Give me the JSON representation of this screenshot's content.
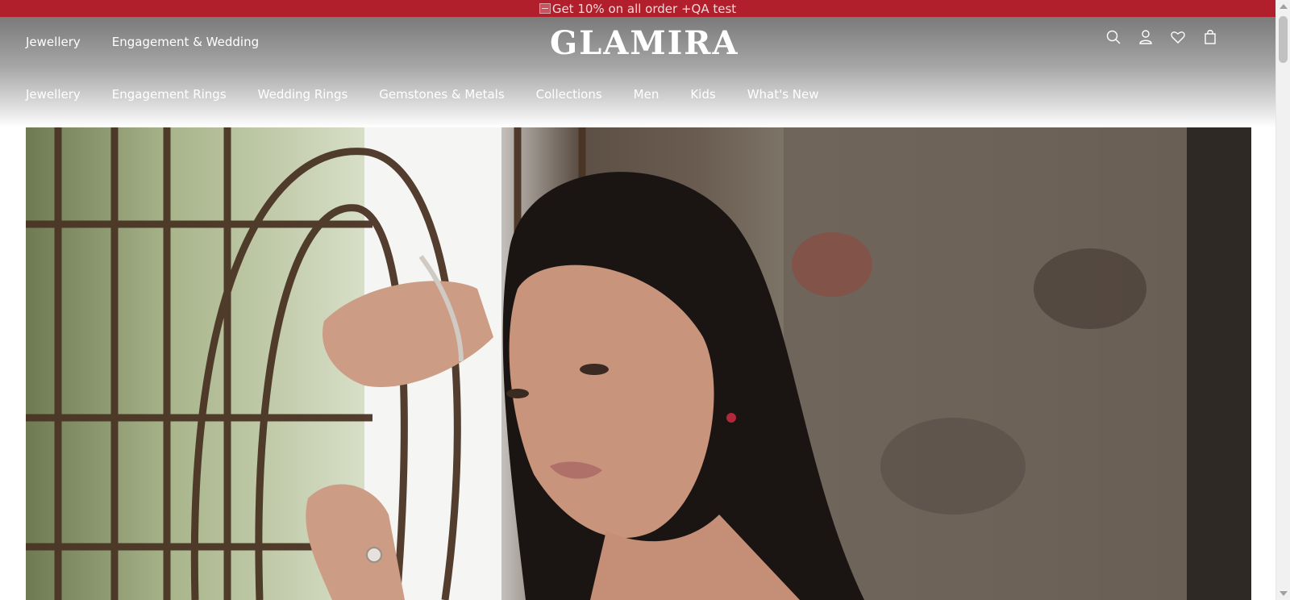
{
  "promo": {
    "text": "Get 10% on all order +QA test"
  },
  "header": {
    "logo": "GLAMIRA",
    "top_nav": [
      "Jewellery",
      "Engagement & Wedding"
    ],
    "main_nav": [
      "Jewellery",
      "Engagement Rings",
      "Wedding Rings",
      "Gemstones & Metals",
      "Collections",
      "Men",
      "Kids",
      "What's New"
    ],
    "icons": [
      "search-icon",
      "account-icon",
      "wishlist-icon",
      "cart-icon"
    ]
  },
  "colors": {
    "promo_bg": "#b01f2b",
    "header_text": "#ffffff"
  }
}
